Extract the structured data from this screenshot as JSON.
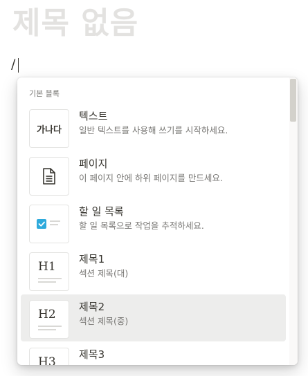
{
  "page": {
    "title": "제목 없음",
    "input_text": "/"
  },
  "menu": {
    "section_label": "기본 블록",
    "items": [
      {
        "title": "텍스트",
        "description": "일반 텍스트를 사용해 쓰기를 시작하세요.",
        "thumb": "가나다",
        "icon": "text-icon"
      },
      {
        "title": "페이지",
        "description": "이 페이지 안에 하위 페이지를 만드세요.",
        "icon": "page-icon"
      },
      {
        "title": "할 일 목록",
        "description": "할 일 목록으로 작업을 추적하세요.",
        "icon": "checkbox-icon"
      },
      {
        "title": "제목1",
        "description": "섹션 제목(대)",
        "thumb": "H1",
        "icon": "heading1-icon"
      },
      {
        "title": "제목2",
        "description": "섹션 제목(중)",
        "thumb": "H2",
        "icon": "heading2-icon",
        "selected": true
      },
      {
        "title": "제목3",
        "description": "",
        "thumb": "H3",
        "icon": "heading3-icon"
      }
    ]
  },
  "colors": {
    "checkbox_accent": "#2eaadc",
    "selected_bg": "#ededec",
    "title_placeholder": "#e3e2e0"
  }
}
